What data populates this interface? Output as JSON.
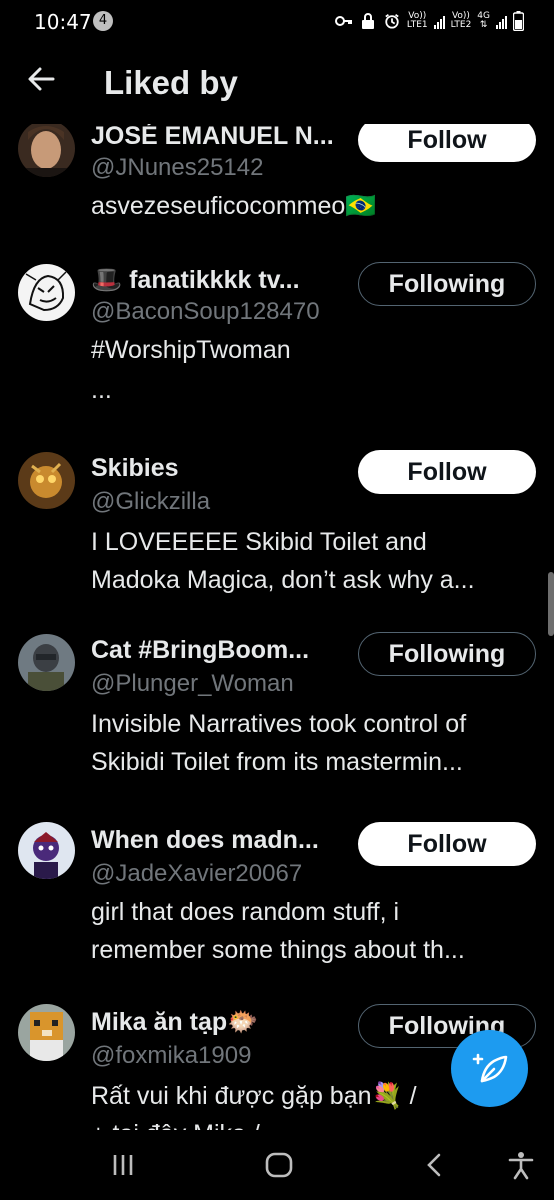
{
  "status_bar": {
    "time": "10:47",
    "notification_count": "4",
    "sim1": "LTE1",
    "sim2": "LTE2",
    "network": "4G",
    "volte1": "Vo))",
    "volte2": "Vo))"
  },
  "header": {
    "title": "Liked by"
  },
  "users": [
    {
      "name": "JOSÉ EMANUEL N...",
      "handle": "@JNunes25142",
      "bio": [
        "asvezeseuficocommeo🇧🇷"
      ],
      "button": "Follow",
      "following": false
    },
    {
      "name": "fanatikkkk tv...",
      "emoji": "🎩",
      "handle": "@BaconSoup128470",
      "bio": [
        "#WorshipTwoman",
        "..."
      ],
      "button": "Following",
      "following": true
    },
    {
      "name": "Skibies",
      "handle": "@Glickzilla",
      "bio": [
        "I LOVEEEEE Skibid Toilet and",
        "Madoka Magica, don’t ask why a..."
      ],
      "button": "Follow",
      "following": false
    },
    {
      "name": "Cat #BringBoom...",
      "handle": "@Plunger_Woman",
      "bio": [
        "Invisible Narratives took control of",
        "Skibidi Toilet from its mastermin..."
      ],
      "button": "Following",
      "following": true
    },
    {
      "name": "When does madn...",
      "handle": "@JadeXavier20067",
      "bio": [
        "girl that does random stuff, i",
        "remember some things about th..."
      ],
      "button": "Follow",
      "following": false
    },
    {
      "name": "Mika ăn tạp🐡",
      "handle": "@foxmika1909",
      "bio": [
        "Rất vui khi được gặp bạn💐 /",
        "+ tại đây Mika /"
      ],
      "button": "Following",
      "following": true
    }
  ],
  "colors": {
    "background": "#000000",
    "text": "#e7e9ea",
    "secondary": "#71767b",
    "accent": "#1d9bf0",
    "button_border": "#536471"
  },
  "icons": {
    "back": "arrow-left-icon",
    "compose": "compose-post-icon",
    "nav_recents": "recents-icon",
    "nav_home": "home-icon",
    "nav_back": "back-icon",
    "nav_accessibility": "accessibility-icon"
  }
}
